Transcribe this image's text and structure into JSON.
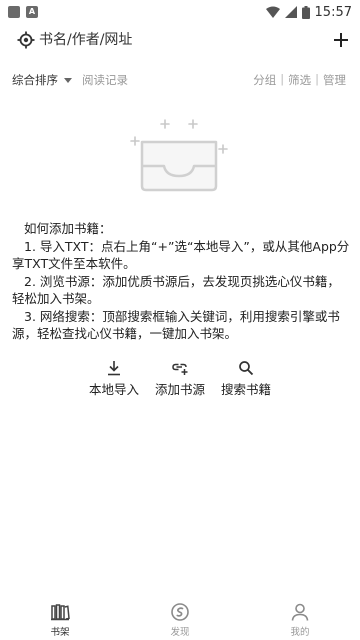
{
  "status_bar": {
    "time": "15:57",
    "notif_a_label": "A"
  },
  "topbar": {
    "search_placeholder": "书名/作者/网址"
  },
  "filter": {
    "sort_label": "综合排序",
    "history_label": "阅读记录",
    "group_label": "分组",
    "filter_label": "筛选",
    "manage_label": "管理",
    "separator": "|"
  },
  "help": {
    "title": "如何添加书籍：",
    "step1": "1. 导入TXT：点右上角“+”选“本地导入”，或从其他App分享TXT文件至本软件。",
    "step2": "2. 浏览书源：添加优质书源后，去发现页挑选心仪书籍，轻松加入书架。",
    "step3": "3. 网络搜索：顶部搜索框输入关键词，利用搜索引擎或书源，轻松查找心仪书籍，一键加入书架。"
  },
  "actions": [
    {
      "label": "本地导入",
      "icon": "download-icon"
    },
    {
      "label": "添加书源",
      "icon": "link-add-icon"
    },
    {
      "label": "搜索书籍",
      "icon": "search-icon"
    }
  ],
  "tabs": [
    {
      "label": "书架",
      "icon": "bookshelf-icon",
      "active": true
    },
    {
      "label": "发现",
      "icon": "discover-icon",
      "active": false
    },
    {
      "label": "我的",
      "icon": "person-icon",
      "active": false
    }
  ],
  "colors": {
    "text": "#222222",
    "muted": "#999999",
    "icon": "#444444"
  }
}
